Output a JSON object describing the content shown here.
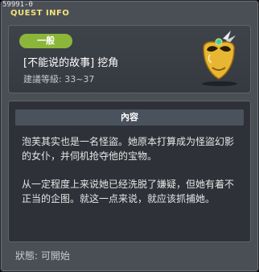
{
  "window": {
    "id_label": "59991-0",
    "title": "QUEST INFO"
  },
  "quest": {
    "category_badge": "一般",
    "name": "[不能说的故事] 挖角",
    "level": "建議等級: 33~37",
    "icon": "golden-mask-icon"
  },
  "content": {
    "header": "內容",
    "paragraph1": "泡芙其实也是一名怪盜。她原本打算成为怪盜幻影的女仆，并伺机抢夺他的宝物。",
    "paragraph2": "从一定程度上来说她已经洗脱了嫌疑，但她有着不正当的企图。就这一点来说，就应该抓捕她。"
  },
  "status": {
    "text": "狀態: 可開始"
  },
  "colors": {
    "title": "#f3e37a",
    "badge": "#8cb63a",
    "panel": "#4a4f56"
  }
}
